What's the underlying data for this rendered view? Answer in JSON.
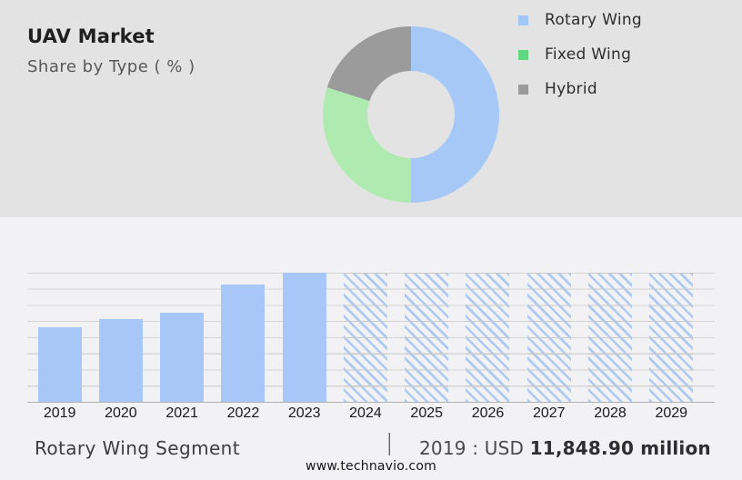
{
  "header": {
    "title": "UAV Market",
    "subtitle": "Share by Type ( % )"
  },
  "legend": {
    "items": [
      {
        "label": "Rotary Wing",
        "color": "#a2c6f5"
      },
      {
        "label": "Fixed Wing",
        "color": "#5fd783"
      },
      {
        "label": "Hybrid",
        "color": "#9b9b9b"
      }
    ]
  },
  "chart_data": [
    {
      "type": "pie",
      "title": "UAV Market Share by Type ( % )",
      "donut": true,
      "start_angle_deg": 0,
      "labels": [
        "Rotary Wing",
        "Fixed Wing",
        "Hybrid"
      ],
      "values": [
        50,
        30,
        20
      ],
      "colors": [
        "#a5c8f7",
        "#afeab0",
        "#9b9b9b"
      ],
      "note": "No numeric labels shown; slice percentages estimated from arc angles (blue 12-to-6 o'clock, green to ~10 o'clock, gray to 12)."
    },
    {
      "type": "bar",
      "categories": [
        "2019",
        "2020",
        "2021",
        "2022",
        "2023",
        "2024",
        "2025",
        "2026",
        "2027",
        "2028",
        "2029"
      ],
      "series": [
        {
          "name": "Rotary Wing segment revenue",
          "values": [
            11848.9,
            13100,
            14100,
            18600,
            20500,
            20500,
            20500,
            20500,
            20500,
            20500,
            20500
          ]
        }
      ],
      "unit": "USD million",
      "ylim": [
        0,
        20500
      ],
      "grid": "horizontal, 8 intervals, no y-axis tick labels",
      "forecast_from": "2024",
      "forecast_style": "diagonal-hatch",
      "solid_color": "#a6c7f7",
      "hatch_color": "#aecaf1",
      "note": "Only 2019 value labeled on the image (USD 11,848.90 million); other solid-bar values estimated from bar heights; 2024-2029 are hatched forecast bars drawn at full height."
    }
  ],
  "caption": {
    "segment_label": "Rotary Wing Segment",
    "separator": "|",
    "value_prefix": "2019 : USD ",
    "value_bold": "11,848.90 million"
  },
  "footer": {
    "url": "www.technavio.com"
  }
}
